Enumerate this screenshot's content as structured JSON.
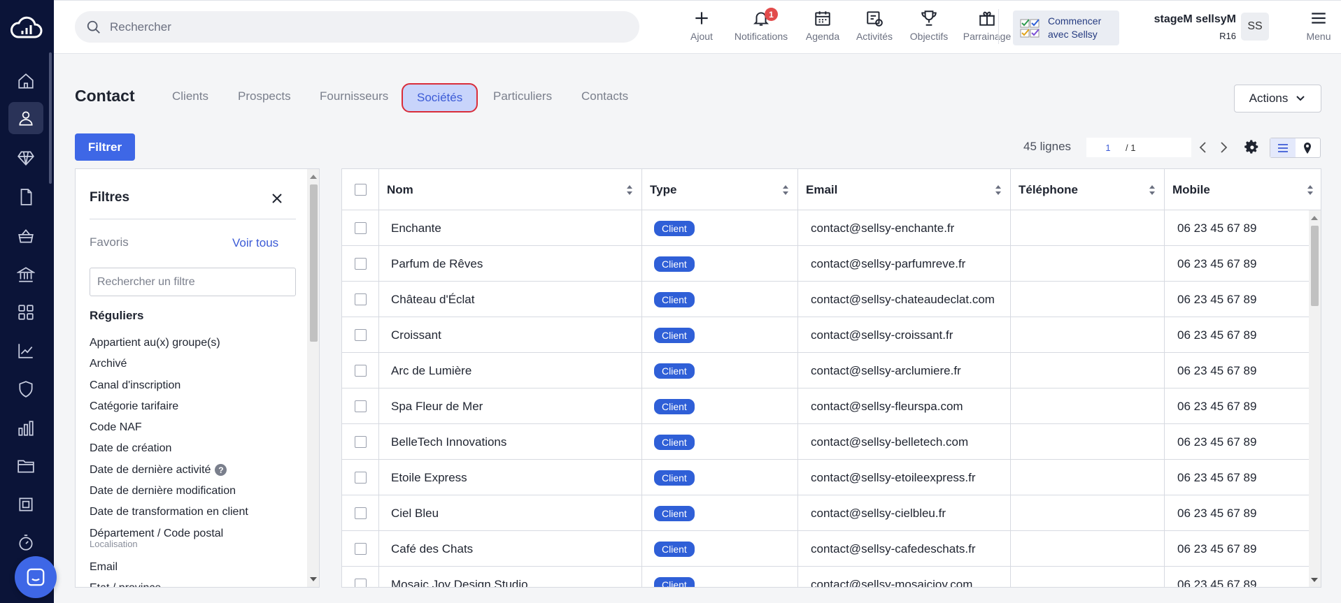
{
  "search": {
    "placeholder": "Rechercher"
  },
  "top_actions": [
    {
      "label": "Ajout",
      "icon": "plus-icon"
    },
    {
      "label": "Notifications",
      "icon": "bell-icon",
      "badge": "1"
    },
    {
      "label": "Agenda",
      "icon": "calendar-icon"
    },
    {
      "label": "Activités",
      "icon": "activities-icon"
    },
    {
      "label": "Objectifs",
      "icon": "trophy-icon"
    },
    {
      "label": "Parrainage",
      "icon": "gift-icon"
    }
  ],
  "start": {
    "line1": "Commencer",
    "line2": "avec Sellsy"
  },
  "user": {
    "name": "stageM sellsyM",
    "code": "R16",
    "initials": "SS"
  },
  "menu_label": "Menu",
  "page_title": "Contact",
  "tabs": [
    {
      "label": "Clients"
    },
    {
      "label": "Prospects"
    },
    {
      "label": "Fournisseurs"
    },
    {
      "label": "Sociétés",
      "active": true
    },
    {
      "label": "Particuliers"
    },
    {
      "label": "Contacts"
    }
  ],
  "actions_label": "Actions",
  "filter_button": "Filtrer",
  "pager": {
    "lines": "45 lignes",
    "page": "1",
    "total": "/ 1"
  },
  "filters": {
    "title": "Filtres",
    "favoris": "Favoris",
    "voir_tous": "Voir tous",
    "search_placeholder": "Rechercher un filtre",
    "section": "Réguliers",
    "items": [
      "Appartient au(x) groupe(s)",
      "Archivé",
      "Canal d'inscription",
      "Catégorie tarifaire",
      "Code NAF",
      "Date de création",
      "Date de dernière activité",
      "Date de dernière modification",
      "Date de transformation en client",
      "Département / Code postal",
      "Email",
      "Etat / province"
    ],
    "item_sub": "Localisation"
  },
  "table": {
    "columns": [
      "Nom",
      "Type",
      "Email",
      "Téléphone",
      "Mobile"
    ],
    "rows": [
      {
        "nom": "Enchante",
        "type": "Client",
        "email": "contact@sellsy-enchante.fr",
        "tel": "",
        "mobile": "06 23 45 67 89"
      },
      {
        "nom": "Parfum de Rêves",
        "type": "Client",
        "email": "contact@sellsy-parfumreve.fr",
        "tel": "",
        "mobile": "06 23 45 67 89"
      },
      {
        "nom": "Château d'Éclat",
        "type": "Client",
        "email": "contact@sellsy-chateaudeclat.com",
        "tel": "",
        "mobile": "06 23 45 67 89"
      },
      {
        "nom": "Croissant",
        "type": "Client",
        "email": "contact@sellsy-croissant.fr",
        "tel": "",
        "mobile": "06 23 45 67 89"
      },
      {
        "nom": "Arc de Lumière",
        "type": "Client",
        "email": "contact@sellsy-arclumiere.fr",
        "tel": "",
        "mobile": "06 23 45 67 89"
      },
      {
        "nom": "Spa Fleur de Mer",
        "type": "Client",
        "email": "contact@sellsy-fleurspa.com",
        "tel": "",
        "mobile": "06 23 45 67 89"
      },
      {
        "nom": "BelleTech Innovations",
        "type": "Client",
        "email": "contact@sellsy-belletech.com",
        "tel": "",
        "mobile": "06 23 45 67 89"
      },
      {
        "nom": "Etoile Express",
        "type": "Client",
        "email": "contact@sellsy-etoileexpress.fr",
        "tel": "",
        "mobile": "06 23 45 67 89"
      },
      {
        "nom": "Ciel Bleu",
        "type": "Client",
        "email": "contact@sellsy-cielbleu.fr",
        "tel": "",
        "mobile": "06 23 45 67 89"
      },
      {
        "nom": "Café des Chats",
        "type": "Client",
        "email": "contact@sellsy-cafedeschats.fr",
        "tel": "",
        "mobile": "06 23 45 67 89"
      },
      {
        "nom": "Mosaic Joy Design Studio",
        "type": "Client",
        "email": "contact@sellsy-mosaicjoy.com",
        "tel": "",
        "mobile": "06 23 45 67 89"
      }
    ]
  },
  "colors": {
    "sidebar": "#0b1438",
    "accent": "#3e67e6",
    "badge": "#2f5fd7",
    "active_tab_border": "#d92d3a"
  }
}
